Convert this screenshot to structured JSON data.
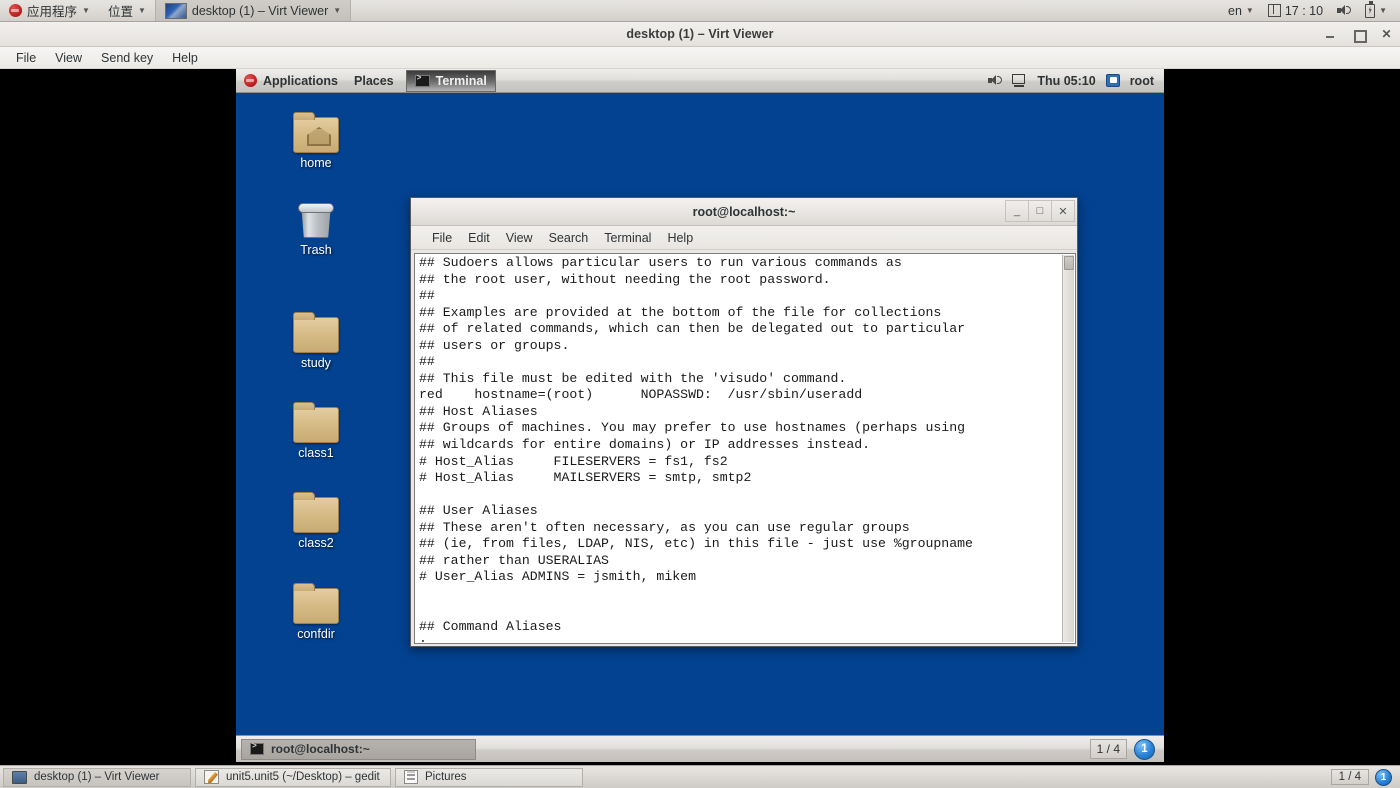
{
  "host_panel": {
    "app_menu": "应用程序",
    "places_menu": "位置",
    "active_task": "desktop (1) – Virt Viewer",
    "keyboard_layout": "en",
    "clock": "17 : 10",
    "icons": [
      "fedora-logo",
      "clock-icon",
      "volume-icon",
      "battery-icon"
    ]
  },
  "virt_viewer": {
    "title": "desktop (1) – Virt Viewer",
    "menu": [
      "File",
      "View",
      "Send key",
      "Help"
    ],
    "window_buttons": [
      "minimize",
      "maximize",
      "close"
    ]
  },
  "vm": {
    "gnome_panel": {
      "applications": "Applications",
      "places": "Places",
      "active_window": "Terminal",
      "clock": "Thu 05:10",
      "user": "root"
    },
    "desktop_icons": [
      {
        "label": "home",
        "type": "home-folder"
      },
      {
        "label": "Trash",
        "type": "trash"
      },
      {
        "label": "study",
        "type": "folder"
      },
      {
        "label": "class1",
        "type": "folder"
      },
      {
        "label": "class2",
        "type": "folder"
      },
      {
        "label": "confdir",
        "type": "folder"
      }
    ],
    "terminal": {
      "title": "root@localhost:~",
      "menu": [
        "File",
        "Edit",
        "View",
        "Search",
        "Terminal",
        "Help"
      ],
      "window_buttons": {
        "minimize": "_",
        "maximize": "□",
        "close": "✕"
      },
      "content": "## Sudoers allows particular users to run various commands as\n## the root user, without needing the root password.\n##\n## Examples are provided at the bottom of the file for collections\n## of related commands, which can then be delegated out to particular\n## users or groups.\n##\n## This file must be edited with the 'visudo' command.\nred    hostname=(root)      NOPASSWD:  /usr/sbin/useradd\n## Host Aliases\n## Groups of machines. You may prefer to use hostnames (perhaps using\n## wildcards for entire domains) or IP addresses instead.\n# Host_Alias     FILESERVERS = fs1, fs2\n# Host_Alias     MAILSERVERS = smtp, smtp2\n\n## User Aliases\n## These aren't often necessary, as you can use regular groups\n## (ie, from files, LDAP, NIS, etc) in this file - just use %groupname\n## rather than USERALIAS\n# User_Alias ADMINS = jsmith, mikem\n\n\n## Command Aliases\n:"
    },
    "taskbar": {
      "task": "root@localhost:~",
      "workspace_switcher": "1 / 4",
      "workspace_badge": "1"
    }
  },
  "host_taskbar": {
    "tasks": [
      {
        "label": "desktop (1) – Virt Viewer",
        "icon": "monitor-icon",
        "active": true
      },
      {
        "label": "unit5.unit5 (~/Desktop) – gedit",
        "icon": "gedit-icon",
        "active": false
      },
      {
        "label": "Pictures",
        "icon": "pictures-icon",
        "active": false
      }
    ],
    "workspace_switcher": "1 / 4",
    "workspace_badge": "1"
  },
  "colors": {
    "desktop_blue": "#034291",
    "panel_grey": "#e2e0dd",
    "accent_blue": "#2b83d6"
  }
}
